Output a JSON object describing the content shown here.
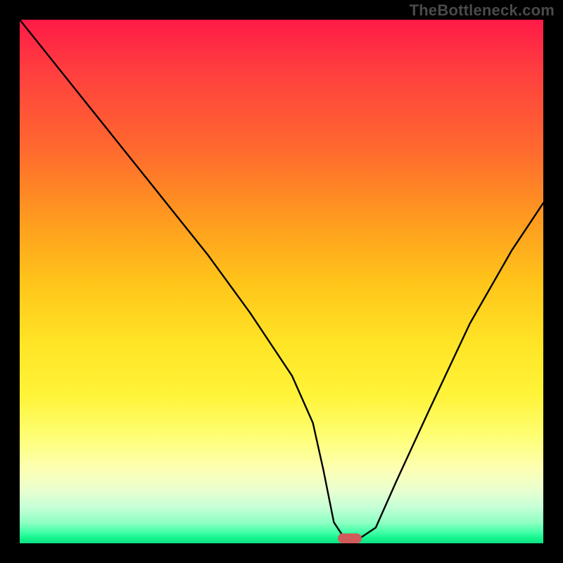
{
  "watermark": {
    "text": "TheBottleneck.com"
  },
  "chart_data": {
    "type": "line",
    "title": "",
    "xlabel": "",
    "ylabel": "",
    "xlim": [
      0,
      100
    ],
    "ylim": [
      0,
      100
    ],
    "grid": false,
    "legend": false,
    "background_gradient": {
      "orientation": "vertical",
      "stops": [
        {
          "pos": 0.0,
          "color": "#ff1a47"
        },
        {
          "pos": 0.5,
          "color": "#ffc41a"
        },
        {
          "pos": 0.8,
          "color": "#feff78"
        },
        {
          "pos": 1.0,
          "color": "#0ee085"
        }
      ]
    },
    "series": [
      {
        "name": "bottleneck-curve",
        "color": "#000000",
        "x": [
          0,
          8,
          16,
          24,
          28,
          36,
          44,
          52,
          56,
          58,
          60,
          62,
          65,
          68,
          72,
          78,
          86,
          94,
          100
        ],
        "y": [
          100,
          90,
          80,
          70,
          65,
          55,
          44,
          32,
          23,
          14,
          4,
          1,
          1,
          3,
          12,
          25,
          42,
          56,
          65
        ]
      }
    ],
    "marker": {
      "name": "optimal-point",
      "x": 63,
      "y": 1,
      "color": "#d15a5a",
      "shape": "pill"
    }
  }
}
